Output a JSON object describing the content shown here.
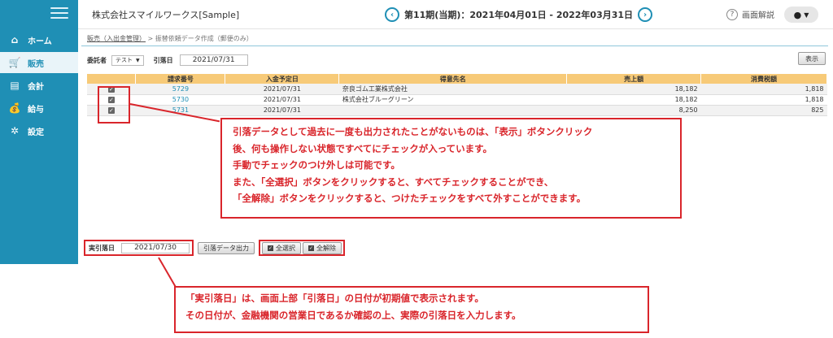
{
  "sidebar": {
    "items": [
      {
        "icon": "home-icon",
        "label": "ホーム",
        "active": false
      },
      {
        "icon": "cart-icon",
        "label": "販売",
        "active": true
      },
      {
        "icon": "calculator-icon",
        "label": "会計",
        "active": false
      },
      {
        "icon": "money-bag-icon",
        "label": "給与",
        "active": false
      },
      {
        "icon": "gear-icon",
        "label": "設定",
        "active": false
      }
    ]
  },
  "header": {
    "company": "株式会社スマイルワークス[Sample]",
    "period": "第11期(当期)：2021年04月01日 - 2022年03月31日",
    "help_label": "画面解説"
  },
  "breadcrumb": {
    "parent": "販売（入出金管理）",
    "separator": ">",
    "current": "振替依頼データ作成（郵便のみ）"
  },
  "filters": {
    "consignor_label": "委託者",
    "consignor_value": "テスト",
    "debit_date_label": "引落日",
    "debit_date_value": "2021/07/31",
    "show_button": "表示"
  },
  "table": {
    "headers": [
      "",
      "請求番号",
      "入金予定日",
      "得意先名",
      "売上額",
      "消費税額"
    ],
    "rows": [
      {
        "invoice": "5729",
        "date": "2021/07/31",
        "customer": "奈良ゴム工業株式会社",
        "sales": "18,182",
        "tax": "1,818"
      },
      {
        "invoice": "5730",
        "date": "2021/07/31",
        "customer": "株式会社ブルーグリーン",
        "sales": "18,182",
        "tax": "1,818"
      },
      {
        "invoice": "5731",
        "date": "2021/07/31",
        "customer": "",
        "sales": "8,250",
        "tax": "825"
      }
    ]
  },
  "callout1": {
    "lines": [
      "引落データとして過去に一度も出力されたことがないものは、「表示」ボタンクリック",
      "後、何も操作しない状態ですべてにチェックが入っています。",
      "手動でチェックのつけ外しは可能です。",
      "また、「全選択」ボタンをクリックすると、すべてチェックすることができ、",
      "「全解除」ボタンをクリックすると、つけたチェックをすべて外すことができます。"
    ]
  },
  "bottom": {
    "actual_date_label": "実引落日",
    "actual_date_value": "2021/07/30",
    "export_button": "引落データ出力",
    "select_all_button": "全選択",
    "deselect_all_button": "全解除"
  },
  "callout2": {
    "lines": [
      "「実引落日」は、画面上部「引落日」の日付が初期値で表示されます。",
      "その日付が、金融機関の営業日であるか確認の上、実際の引落日を入力します。"
    ]
  },
  "colors": {
    "sidebar": "#1f8fb5",
    "table_header": "#f7ca78",
    "annotation_red": "#d9252b"
  }
}
